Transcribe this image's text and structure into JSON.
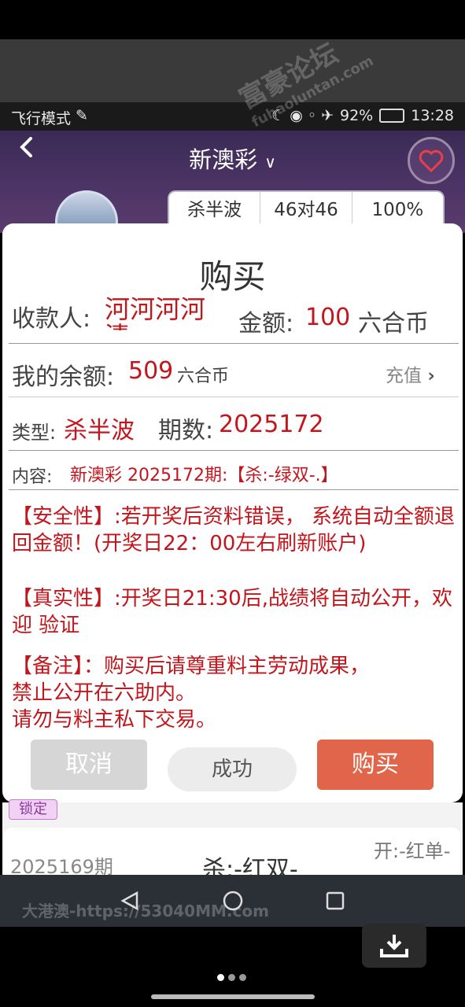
{
  "status": {
    "left": "飞行模式",
    "battery": "92%",
    "time": "13:28"
  },
  "header": {
    "title": "新澳彩",
    "dropdown_glyph": "⌄",
    "back_glyph": "‹"
  },
  "stats": [
    "杀半波",
    "46对46",
    "100%"
  ],
  "dialog": {
    "title": "购买",
    "payee_label": "收款人:",
    "payee_value": "河河河河清",
    "amount_label": "金额:",
    "amount_value": "100",
    "amount_unit": "六合币",
    "balance_label": "我的余额:",
    "balance_value": "509",
    "balance_unit": "六合币",
    "recharge": "充值",
    "type_label": "类型:",
    "type_value": "杀半波",
    "period_label": "期数:",
    "period_value": "2025172",
    "content_label": "内容:",
    "content_value": "新澳彩 2025172期:【杀:-绿双-.】",
    "safety": "【安全性】:若开奖后资料错误， 系统自动全额退回金额！(开奖日22：00左右刷新账户)",
    "truth": "【真实性】:开奖日21:30后,战绩将自动公开，欢迎 验证",
    "remark1": "【备注】：购买后请尊重料主劳动成果，",
    "remark2": "禁止公开在六助内。",
    "remark3": "请勿与料主私下交易。",
    "cancel": "取消",
    "success": "成功",
    "buy": "购买"
  },
  "list": {
    "locked": "锁定",
    "period": "2025169期",
    "content": "杀:-红双-",
    "result": "开:-红单-"
  },
  "watermark": {
    "url": "大港澳-https://53040MM.com",
    "brand": "富豪论坛",
    "domain": "fuhaoluntan.com"
  },
  "colors": {
    "accent_red": "#c3161c",
    "buy_button": "#e0654a",
    "cancel_button": "#d6d6d6"
  }
}
